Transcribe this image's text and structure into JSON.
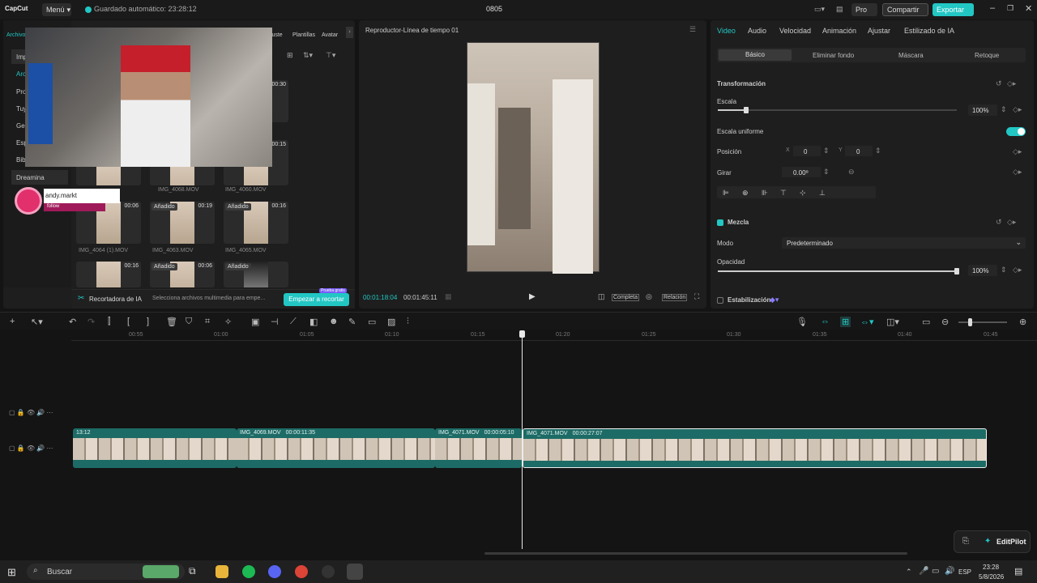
{
  "app": {
    "logo": "CapCut",
    "menu_label": "Menú",
    "autosave": "Guardado automático: 23:28:12",
    "project_title": "0805",
    "pro_label": "Pro",
    "share_label": "Compartir",
    "export_label": "Exportar"
  },
  "colors": {
    "accent": "#22c7c4",
    "clip": "#1d6b66",
    "instagram": "#e1306c"
  },
  "left_toolbar": {
    "items": [
      {
        "label": "Archivo"
      },
      {
        "label": "ajuste"
      },
      {
        "label": "Plantillas"
      },
      {
        "label": "Avatar"
      }
    ]
  },
  "left_sidebar": {
    "items": [
      {
        "label": "Impo"
      },
      {
        "label": "Arch"
      },
      {
        "label": "Proy"
      },
      {
        "label": "Tuyo"
      },
      {
        "label": "Gene"
      },
      {
        "label": "Espa"
      },
      {
        "label": "Bibli"
      },
      {
        "label": "Dreamina"
      }
    ]
  },
  "overlay": {
    "username": "andy.markt",
    "follow": "follow"
  },
  "media": {
    "cards": [
      {
        "added": "",
        "dur": "00:30",
        "name": ""
      },
      {
        "added": "",
        "dur": "00:15",
        "name": ""
      },
      {
        "added": "",
        "dur": "",
        "name": "IMG_4068.MOV"
      },
      {
        "added": "",
        "dur": "",
        "name": "IMG_4060.MOV"
      },
      {
        "added": "",
        "dur": "00:06",
        "name": "IMG_4064 (1).MOV"
      },
      {
        "added": "Añadido",
        "dur": "00:19",
        "name": "IMG_4063.MOV"
      },
      {
        "added": "Añadido",
        "dur": "00:16",
        "name": "IMG_4065.MOV"
      },
      {
        "added": "",
        "dur": "00:16",
        "name": ""
      },
      {
        "added": "Añadido",
        "dur": "00:06",
        "name": ""
      },
      {
        "added": "Añadido",
        "dur": "",
        "name": ""
      }
    ]
  },
  "ai_bar": {
    "label": "Recortadora de IA",
    "text": "Selecciona archivos multimedia para empe...",
    "button": "Empezar a recortar",
    "badge": "Prueba gratis"
  },
  "player": {
    "title": "Reproductor-Línea de tiempo 01",
    "current": "00:01:18:04",
    "total": "00:01:45:11",
    "full_label": "Completa",
    "ratio_label": "Relación"
  },
  "inspector": {
    "tabs": [
      "Video",
      "Audio",
      "Velocidad",
      "Animación",
      "Ajustar",
      "Estilizado de IA"
    ],
    "subtabs": [
      "Básico",
      "Eliminar fondo",
      "Máscara",
      "Retoque"
    ],
    "transform": "Transformación",
    "scale": "Escala",
    "scale_value": "100%",
    "scale_level": 0.12,
    "uniform": "Escala uniforme",
    "position": "Posición",
    "pos_x_label": "X",
    "pos_x": "0",
    "pos_y_label": "Y",
    "pos_y": "0",
    "rotate": "Girar",
    "rotate_value": "0.00º",
    "blend": "Mezcla",
    "mode": "Modo",
    "mode_value": "Predeterminado",
    "opacity": "Opacidad",
    "opacity_value": "100%",
    "opacity_level": 1.0,
    "stabilization": "Estabilización"
  },
  "timeline": {
    "ruler": [
      "00:55",
      "01:00",
      "01:05",
      "01:10",
      "01:15",
      "01:20",
      "01:25",
      "01:30",
      "01:35",
      "01:40",
      "01:45"
    ],
    "clips": [
      {
        "name": "",
        "dur": "13:12"
      },
      {
        "name": "IMG_4069.MOV",
        "dur": "00:00:11:35"
      },
      {
        "name": "IMG_4071.MOV",
        "dur": "00:00:05:10"
      },
      {
        "name": "IMG_4071.MOV",
        "dur": "00:00:27:07"
      }
    ]
  },
  "editpilot": "EditPilot",
  "taskbar": {
    "search": "Buscar",
    "lang": "ESP",
    "time": "23:28",
    "date": "5/8/2026"
  }
}
